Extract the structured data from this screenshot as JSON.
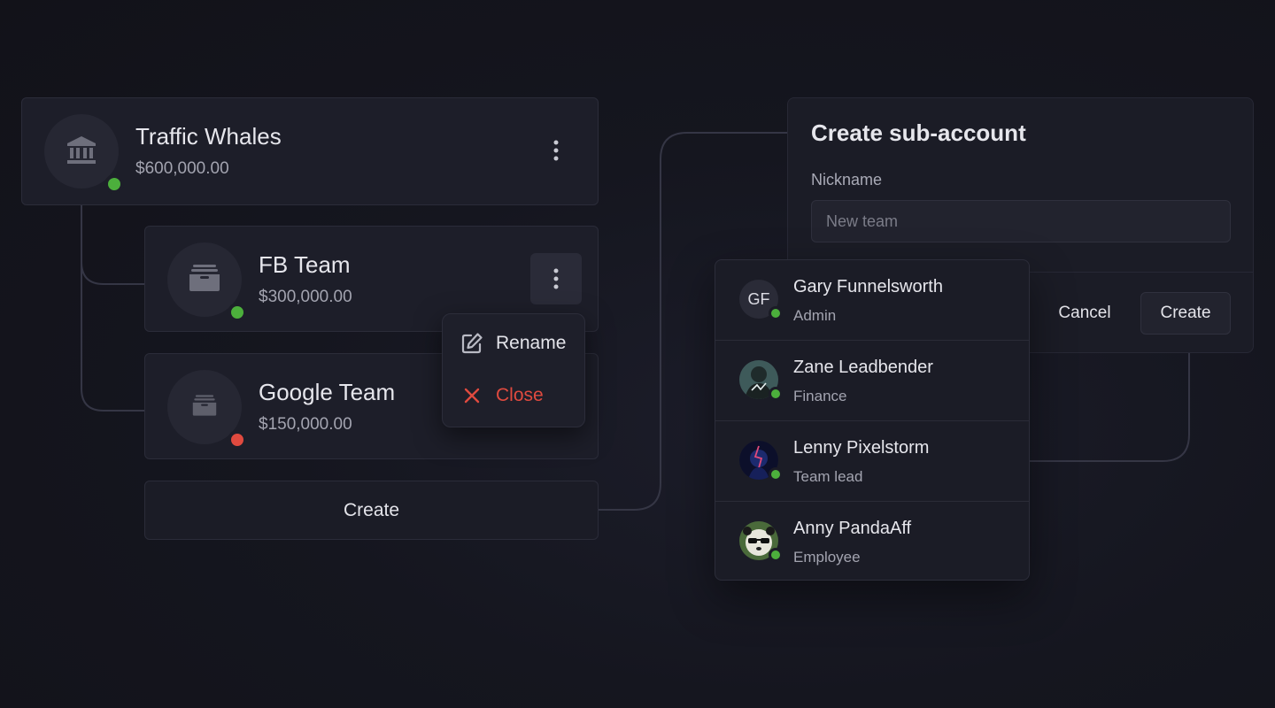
{
  "colors": {
    "background": "#15161f",
    "card": "#1d1e29",
    "status_active": "#4caf3c",
    "status_closed": "#e04a3f",
    "danger": "#e04a3f"
  },
  "accounts": [
    {
      "name": "Traffic Whales",
      "balance": "$600,000.00",
      "icon": "bank-icon",
      "status": "active"
    },
    {
      "name": "FB Team",
      "balance": "$300,000.00",
      "icon": "wallet-icon",
      "status": "active"
    },
    {
      "name": "Google Team",
      "balance": "$150,000.00",
      "icon": "wallet-icon",
      "status": "closed"
    }
  ],
  "create_button_label": "Create",
  "context_menu": {
    "items": [
      {
        "label": "Rename",
        "icon": "edit-icon"
      },
      {
        "label": "Close",
        "icon": "close-icon"
      }
    ]
  },
  "dialog": {
    "title": "Create sub-account",
    "nickname_label": "Nickname",
    "nickname_placeholder": "New team",
    "nickname_value": "",
    "cancel_label": "Cancel",
    "create_label": "Create"
  },
  "users": [
    {
      "name": "Gary Funnelsworth",
      "role": "Admin",
      "initials": "GF"
    },
    {
      "name": "Zane Leadbender",
      "role": "Finance",
      "initials": ""
    },
    {
      "name": "Lenny Pixelstorm",
      "role": "Team lead",
      "initials": ""
    },
    {
      "name": "Anny PandaAff",
      "role": "Employee",
      "initials": ""
    }
  ]
}
